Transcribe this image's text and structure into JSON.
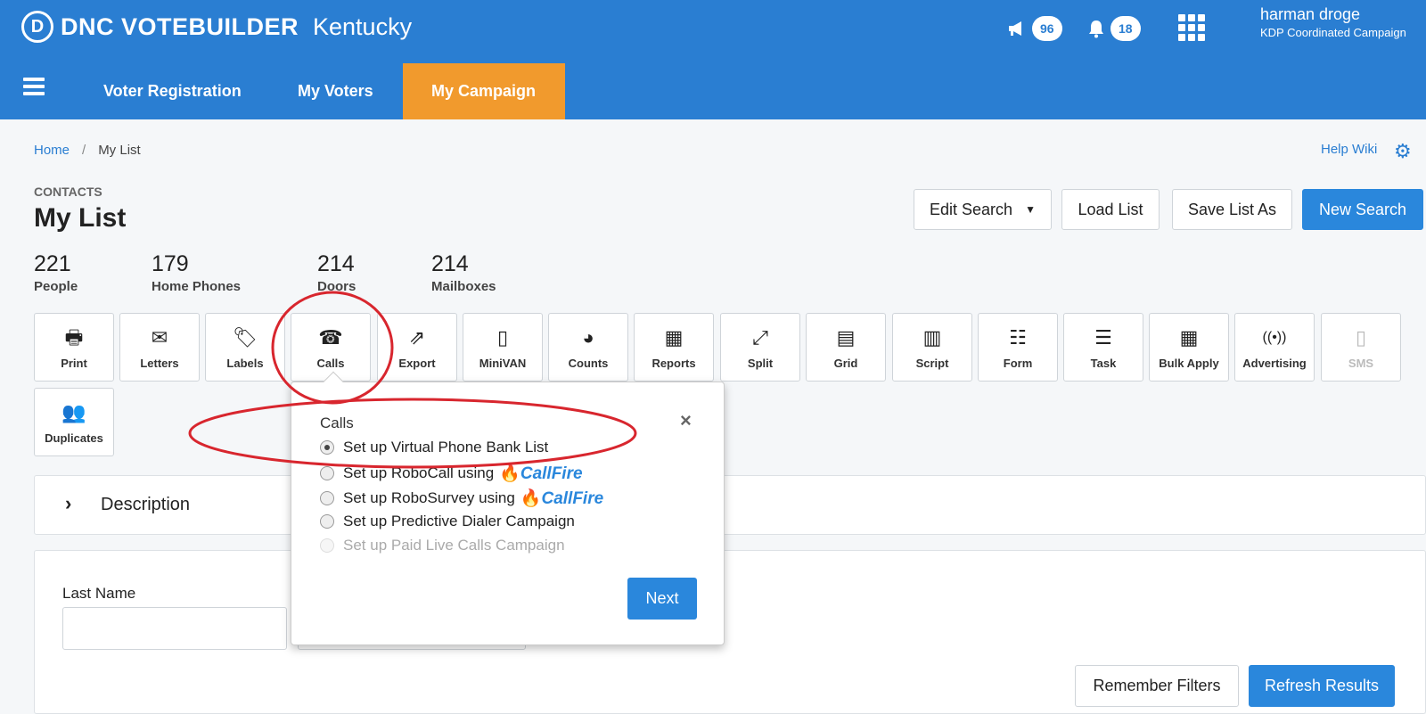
{
  "header": {
    "logo_letter": "D",
    "brand": "DNC VOTEBUILDER",
    "state": "Kentucky",
    "announcements_count": "96",
    "notifications_count": "18",
    "user_name": "harman droge",
    "user_org": "KDP Coordinated Campaign",
    "accent": "#2a7ed2",
    "active_tab_color": "#f19a2d"
  },
  "nav": {
    "tabs": [
      {
        "label": "Voter Registration"
      },
      {
        "label": "My Voters"
      },
      {
        "label": "My Campaign"
      }
    ]
  },
  "breadcrumb": {
    "home": "Home",
    "separator": "/",
    "current": "My List"
  },
  "help": {
    "wiki": "Help Wiki",
    "gear_icon": "⚙"
  },
  "page": {
    "section": "CONTACTS",
    "title": "My List"
  },
  "actions": {
    "edit_search": "Edit Search",
    "load_list": "Load List",
    "save_list_as": "Save List As",
    "new_search": "New Search"
  },
  "stats": [
    {
      "value": "221",
      "label": "People"
    },
    {
      "value": "179",
      "label": "Home Phones"
    },
    {
      "value": "214",
      "label": "Doors"
    },
    {
      "value": "214",
      "label": "Mailboxes"
    }
  ],
  "tools": [
    {
      "label": "Print",
      "icon": "🖶"
    },
    {
      "label": "Letters",
      "icon": "✉"
    },
    {
      "label": "Labels",
      "icon": "🏷"
    },
    {
      "label": "Calls",
      "icon": "☎"
    },
    {
      "label": "Export",
      "icon": "⇗"
    },
    {
      "label": "MiniVAN",
      "icon": "▯"
    },
    {
      "label": "Counts",
      "icon": "◕"
    },
    {
      "label": "Reports",
      "icon": "▦"
    },
    {
      "label": "Split",
      "icon": "⤢"
    },
    {
      "label": "Grid",
      "icon": "▤"
    },
    {
      "label": "Script",
      "icon": "▥"
    },
    {
      "label": "Form",
      "icon": "☷"
    },
    {
      "label": "Task",
      "icon": "☰"
    },
    {
      "label": "Bulk Apply",
      "icon": "▦"
    },
    {
      "label": "Advertising",
      "icon": "((•))"
    },
    {
      "label": "SMS",
      "icon": "▯"
    },
    {
      "label": "Duplicates",
      "icon": "👥"
    }
  ],
  "description": {
    "title": "Description",
    "chevron": "›"
  },
  "filters": {
    "last_name_label": "Last Name",
    "remember": "Remember Filters",
    "refresh": "Refresh Results"
  },
  "popover": {
    "title": "Calls",
    "close": "×",
    "options": [
      {
        "label": "Set up Virtual Phone Bank List",
        "selected": true,
        "disabled": false
      },
      {
        "label": "Set up RoboCall using",
        "selected": false,
        "disabled": false,
        "logo": "CallFire"
      },
      {
        "label": "Set up RoboSurvey using",
        "selected": false,
        "disabled": false,
        "logo": "CallFire"
      },
      {
        "label": "Set up Predictive Dialer Campaign",
        "selected": false,
        "disabled": false
      },
      {
        "label": "Set up Paid Live Calls Campaign",
        "selected": false,
        "disabled": true
      }
    ],
    "next": "Next"
  }
}
